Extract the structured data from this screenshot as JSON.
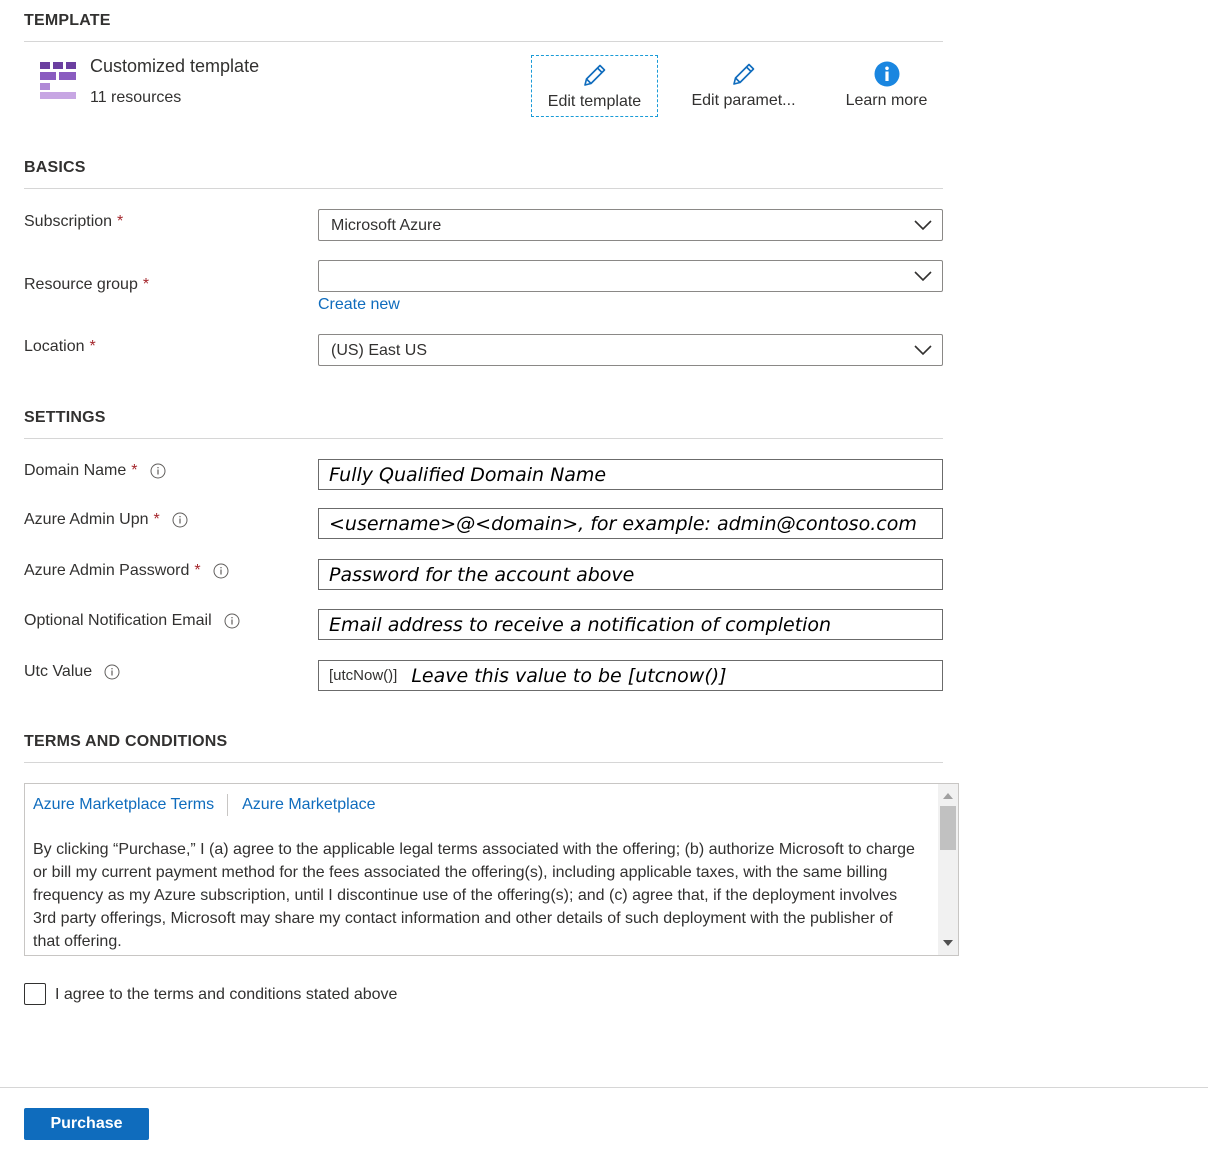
{
  "template": {
    "section_title": "TEMPLATE",
    "name": "Customized template",
    "resource_count": "11 resources",
    "actions": [
      {
        "label": "Edit template",
        "icon": "pencil-icon"
      },
      {
        "label": "Edit paramet...",
        "icon": "pencil-icon"
      },
      {
        "label": "Learn more",
        "icon": "info-icon"
      }
    ]
  },
  "basics": {
    "section_title": "BASICS",
    "subscription": {
      "label": "Subscription",
      "value": "Microsoft Azure"
    },
    "resource_group": {
      "label": "Resource group",
      "value": "",
      "create_new": "Create new"
    },
    "location": {
      "label": "Location",
      "value": "(US) East US"
    }
  },
  "settings": {
    "section_title": "SETTINGS",
    "domain_name": {
      "label": "Domain Name",
      "hint": "Fully Qualified Domain Name"
    },
    "admin_upn": {
      "label": "Azure Admin Upn",
      "hint": "<username>@<domain>, for example: admin@contoso.com"
    },
    "admin_password": {
      "label": "Azure Admin Password",
      "hint": "Password for the account above"
    },
    "notification_email": {
      "label": "Optional Notification Email",
      "hint": "Email address to receive a notification of completion"
    },
    "utc_value": {
      "label": "Utc Value",
      "value": "[utcNow()]",
      "hint": "Leave this value to be [utcnow()]"
    }
  },
  "terms": {
    "section_title": "TERMS AND CONDITIONS",
    "tabs": [
      "Azure Marketplace Terms",
      "Azure Marketplace"
    ],
    "text": "By clicking “Purchase,” I (a) agree to the applicable legal terms associated with the offering; (b) authorize Microsoft to charge or bill my current payment method for the fees associated the offering(s), including applicable taxes, with the same billing frequency as my Azure subscription, until I discontinue use of the offering(s); and (c) agree that, if the deployment involves 3rd party offerings, Microsoft may share my contact information and other details of such deployment with the publisher of that offering.",
    "agree_label": "I agree to the terms and conditions stated above"
  },
  "footer": {
    "purchase_label": "Purchase"
  },
  "colors": {
    "accent": "#0f6cbd",
    "required": "#a4262c",
    "template_icon": "#8a4fb0"
  }
}
